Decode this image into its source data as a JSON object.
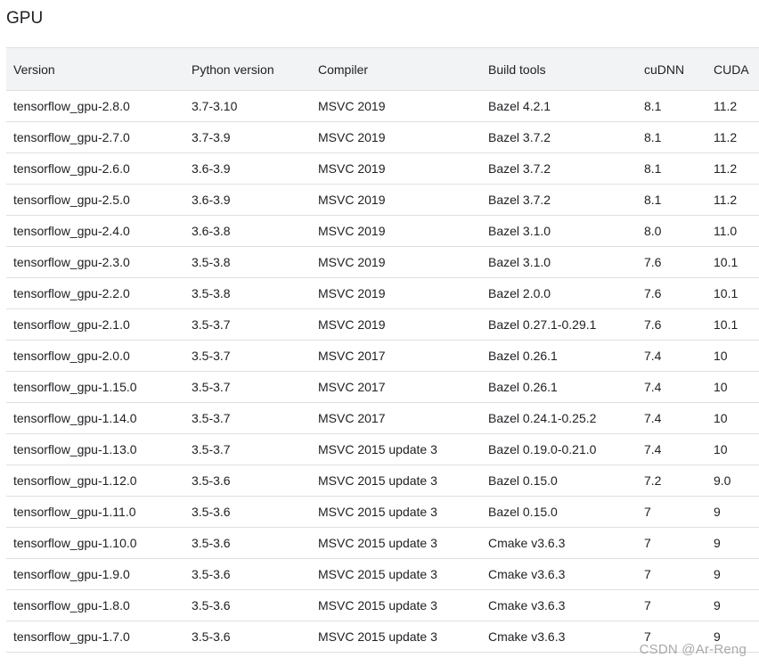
{
  "section": {
    "title": "GPU"
  },
  "table": {
    "headers": [
      "Version",
      "Python version",
      "Compiler",
      "Build tools",
      "cuDNN",
      "CUDA"
    ],
    "rows": [
      [
        "tensorflow_gpu-2.8.0",
        "3.7-3.10",
        "MSVC 2019",
        "Bazel 4.2.1",
        "8.1",
        "11.2"
      ],
      [
        "tensorflow_gpu-2.7.0",
        "3.7-3.9",
        "MSVC 2019",
        "Bazel 3.7.2",
        "8.1",
        "11.2"
      ],
      [
        "tensorflow_gpu-2.6.0",
        "3.6-3.9",
        "MSVC 2019",
        "Bazel 3.7.2",
        "8.1",
        "11.2"
      ],
      [
        "tensorflow_gpu-2.5.0",
        "3.6-3.9",
        "MSVC 2019",
        "Bazel 3.7.2",
        "8.1",
        "11.2"
      ],
      [
        "tensorflow_gpu-2.4.0",
        "3.6-3.8",
        "MSVC 2019",
        "Bazel 3.1.0",
        "8.0",
        "11.0"
      ],
      [
        "tensorflow_gpu-2.3.0",
        "3.5-3.8",
        "MSVC 2019",
        "Bazel 3.1.0",
        "7.6",
        "10.1"
      ],
      [
        "tensorflow_gpu-2.2.0",
        "3.5-3.8",
        "MSVC 2019",
        "Bazel 2.0.0",
        "7.6",
        "10.1"
      ],
      [
        "tensorflow_gpu-2.1.0",
        "3.5-3.7",
        "MSVC 2019",
        "Bazel 0.27.1-0.29.1",
        "7.6",
        "10.1"
      ],
      [
        "tensorflow_gpu-2.0.0",
        "3.5-3.7",
        "MSVC 2017",
        "Bazel 0.26.1",
        "7.4",
        "10"
      ],
      [
        "tensorflow_gpu-1.15.0",
        "3.5-3.7",
        "MSVC 2017",
        "Bazel 0.26.1",
        "7.4",
        "10"
      ],
      [
        "tensorflow_gpu-1.14.0",
        "3.5-3.7",
        "MSVC 2017",
        "Bazel 0.24.1-0.25.2",
        "7.4",
        "10"
      ],
      [
        "tensorflow_gpu-1.13.0",
        "3.5-3.7",
        "MSVC 2015 update 3",
        "Bazel 0.19.0-0.21.0",
        "7.4",
        "10"
      ],
      [
        "tensorflow_gpu-1.12.0",
        "3.5-3.6",
        "MSVC 2015 update 3",
        "Bazel 0.15.0",
        "7.2",
        "9.0"
      ],
      [
        "tensorflow_gpu-1.11.0",
        "3.5-3.6",
        "MSVC 2015 update 3",
        "Bazel 0.15.0",
        "7",
        "9"
      ],
      [
        "tensorflow_gpu-1.10.0",
        "3.5-3.6",
        "MSVC 2015 update 3",
        "Cmake v3.6.3",
        "7",
        "9"
      ],
      [
        "tensorflow_gpu-1.9.0",
        "3.5-3.6",
        "MSVC 2015 update 3",
        "Cmake v3.6.3",
        "7",
        "9"
      ],
      [
        "tensorflow_gpu-1.8.0",
        "3.5-3.6",
        "MSVC 2015 update 3",
        "Cmake v3.6.3",
        "7",
        "9"
      ],
      [
        "tensorflow_gpu-1.7.0",
        "3.5-3.6",
        "MSVC 2015 update 3",
        "Cmake v3.6.3",
        "7",
        "9"
      ]
    ]
  },
  "watermark": {
    "text": "CSDN @Ar-Reng"
  }
}
